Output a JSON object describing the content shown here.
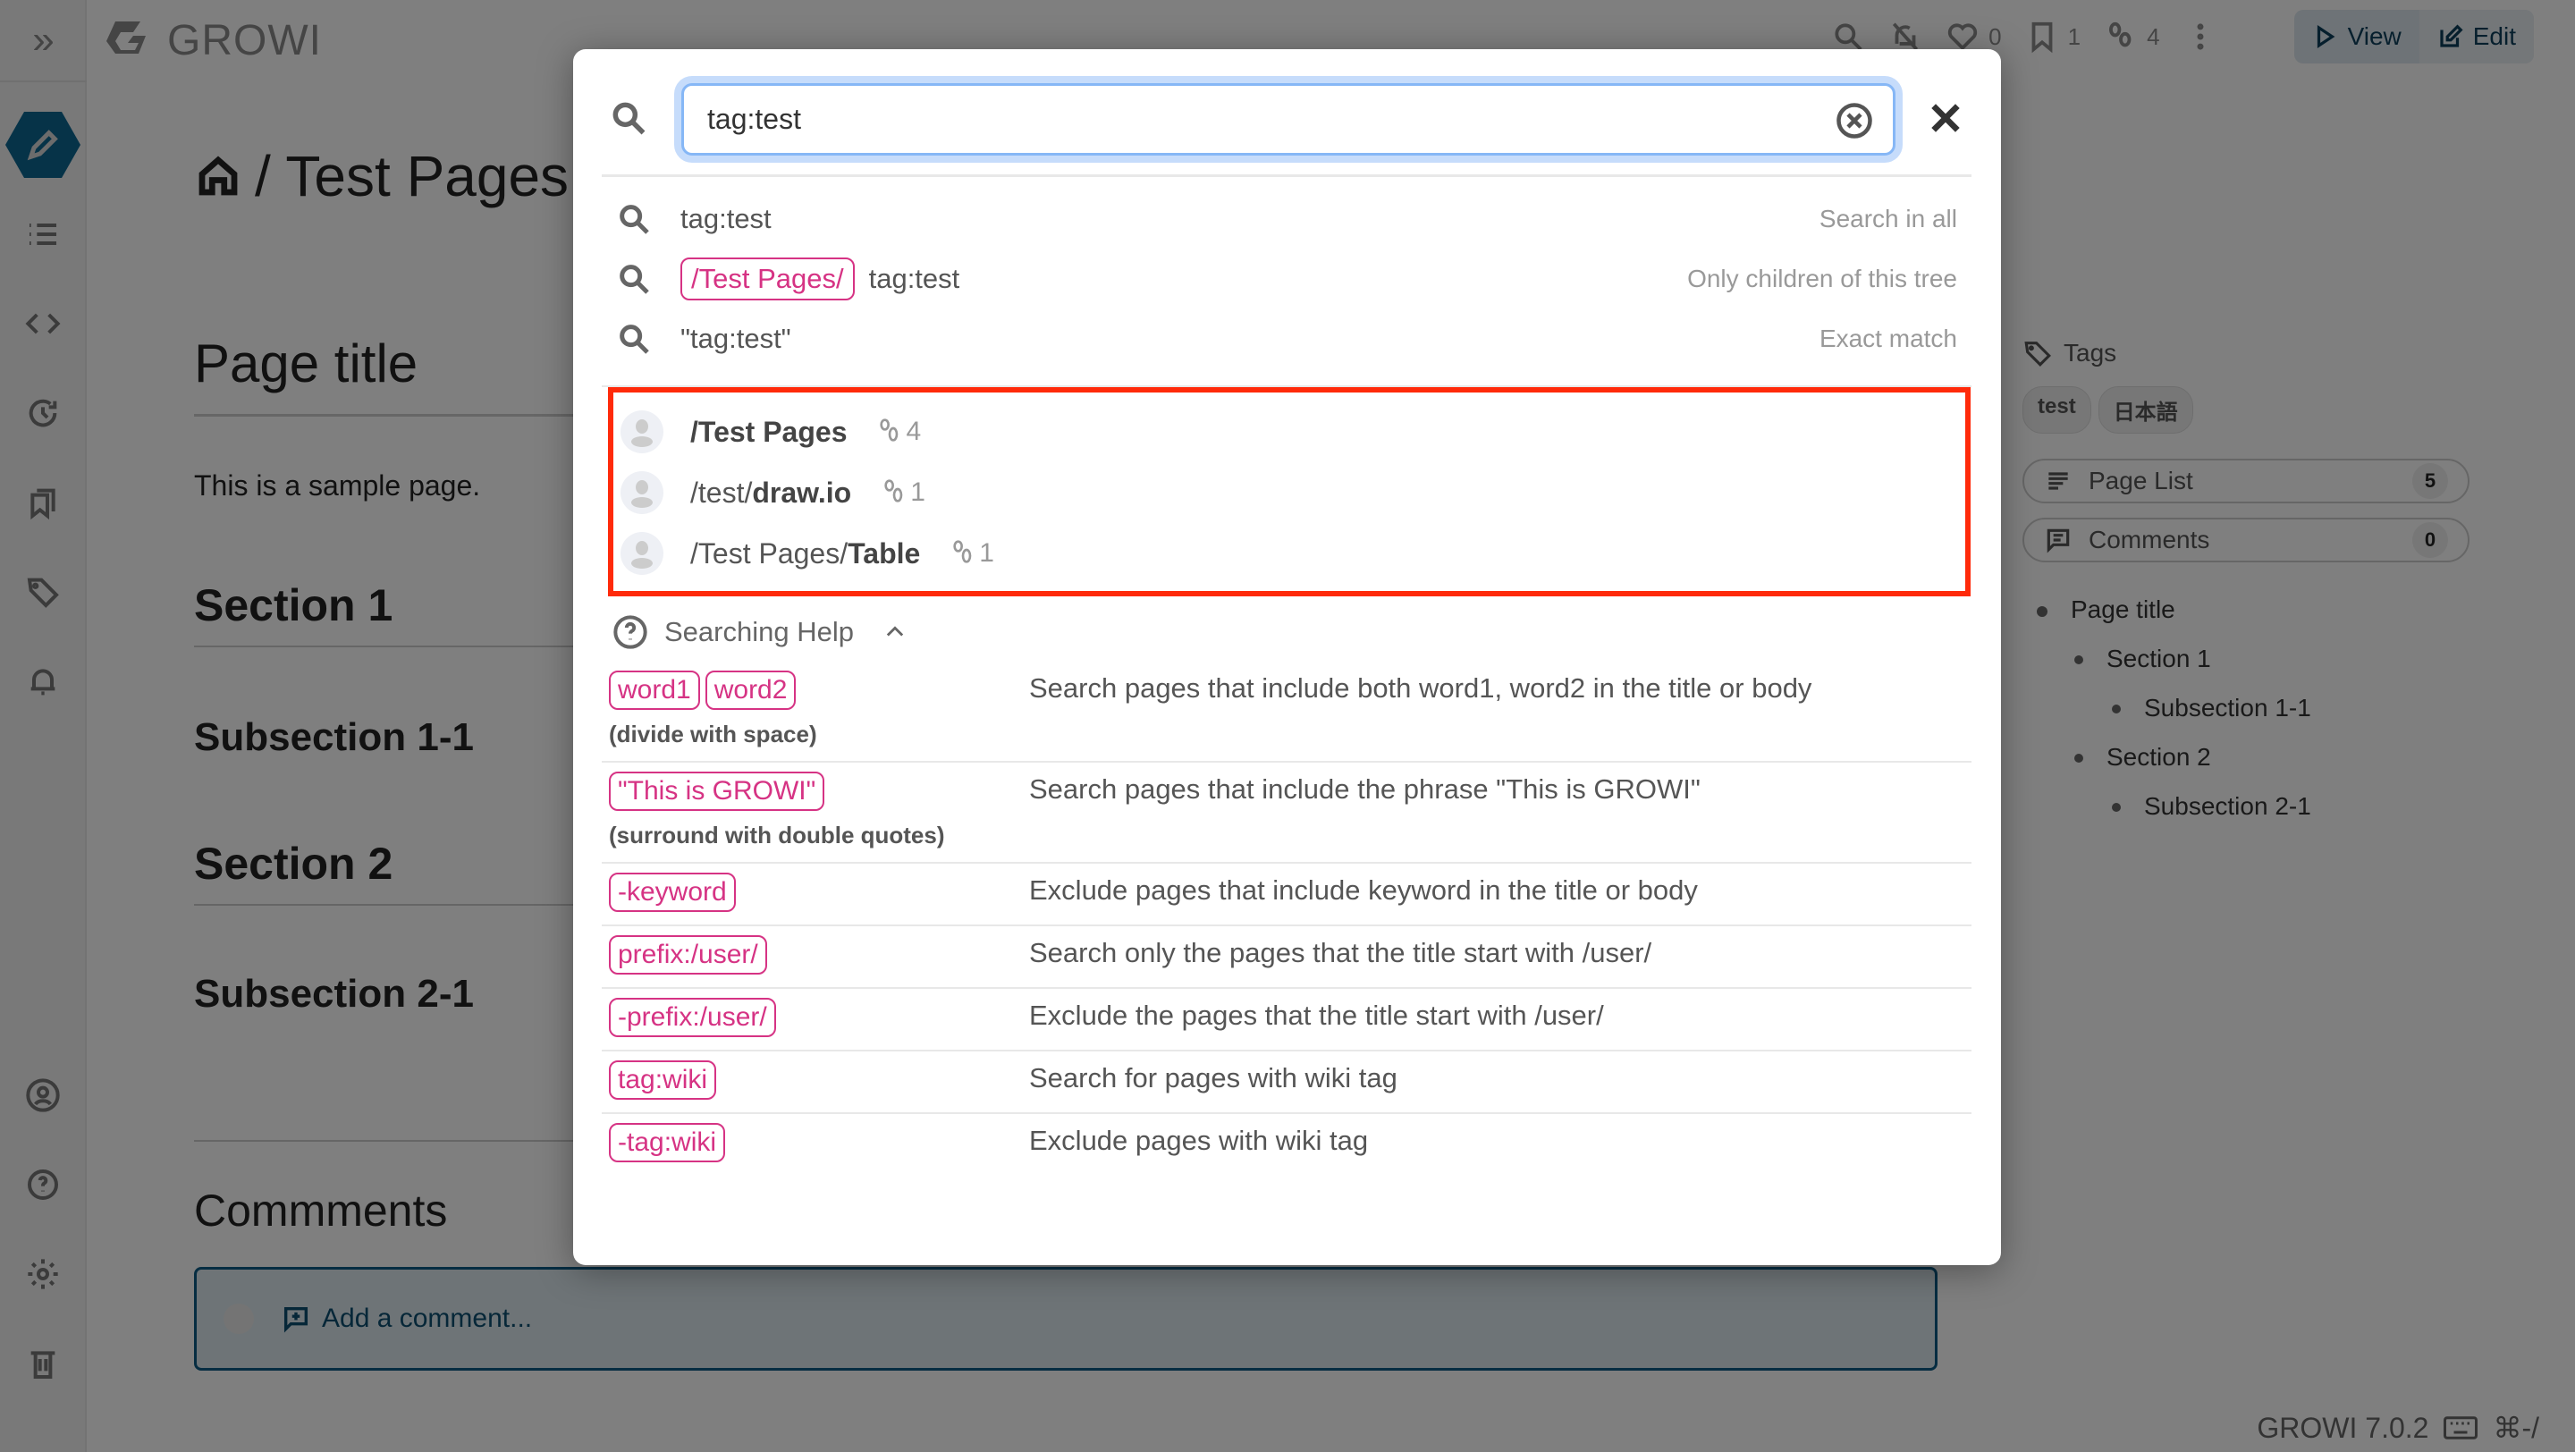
{
  "app": {
    "name": "GROWI",
    "version": "GROWI 7.0.2",
    "shortcut_hint": "⌘-/"
  },
  "topbar": {
    "like_count": "0",
    "bookmark_count": "1",
    "seen_count": "4",
    "view_label": "View",
    "edit_label": "Edit"
  },
  "page": {
    "breadcrumb": "/ Test Pages",
    "title": "Page title",
    "intro": "This is a sample page.",
    "section1": "Section 1",
    "subsection11": "Subsection 1-1",
    "section2": "Section 2",
    "subsection21": "Subsection 2-1",
    "comments_title": "Commments",
    "add_comment": "Add a comment..."
  },
  "sidebar_right": {
    "tags_label": "Tags",
    "tags": [
      "test",
      "日本語"
    ],
    "page_list_label": "Page List",
    "page_list_count": "5",
    "comments_label": "Comments",
    "comments_count": "0",
    "toc": [
      {
        "label": "Page title",
        "level": 0
      },
      {
        "label": "Section 1",
        "level": 1
      },
      {
        "label": "Subsection 1-1",
        "level": 2
      },
      {
        "label": "Section 2",
        "level": 1
      },
      {
        "label": "Subsection 2-1",
        "level": 2
      }
    ]
  },
  "search_modal": {
    "query": "tag:test",
    "suggestions": [
      {
        "scope": "",
        "query": "tag:test",
        "hint": "Search in all"
      },
      {
        "scope": "/Test Pages/",
        "query": "tag:test",
        "hint": "Only children of this tree"
      },
      {
        "scope": "",
        "query": "\"tag:test\"",
        "hint": "Exact match"
      }
    ],
    "results": [
      {
        "prefix": "",
        "bold": "/Test Pages",
        "seen": "4"
      },
      {
        "prefix": "/test/",
        "bold": "draw.io",
        "seen": "1"
      },
      {
        "prefix": "/Test Pages/",
        "bold": "Table",
        "seen": "1"
      }
    ],
    "help_title": "Searching Help",
    "help_rows": [
      {
        "keys": [
          "word1",
          "word2"
        ],
        "note": "(divide with space)",
        "desc": "Search pages that include both word1, word2 in the title or body"
      },
      {
        "keys": [
          "\"This is GROWI\""
        ],
        "note": "(surround with double quotes)",
        "desc": "Search pages that include the phrase \"This is GROWI\""
      },
      {
        "keys": [
          "-keyword"
        ],
        "note": "",
        "desc": "Exclude pages that include keyword in the title or body"
      },
      {
        "keys": [
          "prefix:/user/"
        ],
        "note": "",
        "desc": "Search only the pages that the title start with /user/"
      },
      {
        "keys": [
          "-prefix:/user/"
        ],
        "note": "",
        "desc": "Exclude the pages that the title start with /user/"
      },
      {
        "keys": [
          "tag:wiki"
        ],
        "note": "",
        "desc": "Search for pages with wiki tag"
      },
      {
        "keys": [
          "-tag:wiki"
        ],
        "note": "",
        "desc": "Exclude pages with wiki tag"
      }
    ]
  },
  "colors": {
    "accent": "#d63384",
    "brand": "#0d6690",
    "highlight_box": "#ff2a0a",
    "focus_ring": "#86b7f6"
  }
}
